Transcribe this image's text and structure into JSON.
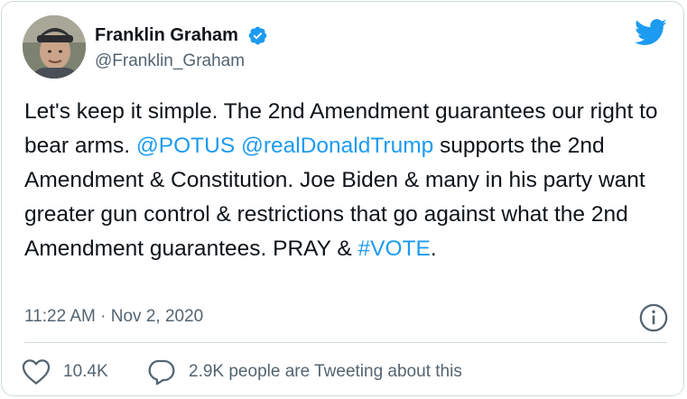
{
  "author": {
    "display_name": "Franklin Graham",
    "handle": "@Franklin_Graham",
    "verified_icon": "verified-badge-icon",
    "avatar": "profile-photo"
  },
  "brand": {
    "logo_icon": "twitter-bird-icon",
    "accent_color": "#1d9bf0"
  },
  "tweet": {
    "segments": [
      "Let's keep it simple. The 2nd Amendment guarantees our right to bear arms. ",
      "@POTUS",
      " ",
      "@realDonaldTrump",
      " supports the 2nd Amendment & Constitution. Joe Biden & many in his party want greater gun control & restrictions that go against what the 2nd Amendment guarantees. PRAY & ",
      "#VOTE",
      "."
    ],
    "timestamp": "11:22 AM · Nov 2, 2020"
  },
  "actions": {
    "likes": "10.4K",
    "like_icon": "heart-icon",
    "reply_icon": "reply-bubble-icon",
    "tweeting_about": "2.9K people are Tweeting about this",
    "info_icon": "info-icon"
  }
}
